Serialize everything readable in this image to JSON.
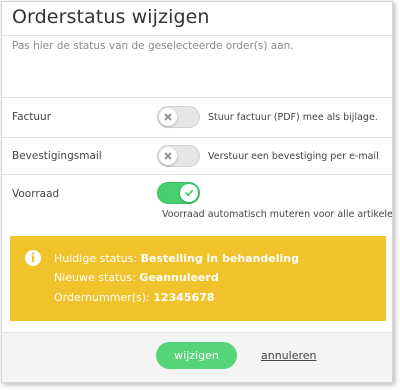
{
  "dialog": {
    "title": "Orderstatus wijzigen",
    "subtitle": "Pas hier de status van de geselecteerde order(s) aan."
  },
  "options": [
    {
      "label": "Factuur",
      "enabled": false,
      "knob_icon": "x-icon",
      "description": "Stuur factuur (PDF) mee als bijlage."
    },
    {
      "label": "Bevestigingsmail",
      "enabled": false,
      "knob_icon": "x-icon",
      "description": "Verstuur een bevestiging per e-mail"
    },
    {
      "label": "Voorraad",
      "enabled": true,
      "knob_icon": "check-icon",
      "description": "Voorraad automatisch muteren voor alle artikelen."
    }
  ],
  "info": {
    "icon": "info-icon",
    "current_label": "Huidige status:",
    "current_value": "Bestelling in behandeling",
    "new_label": "Nieuwe status:",
    "new_value": "Geannuleerd",
    "order_label": "Ordernummer(s):",
    "order_value": "12345678"
  },
  "actions": {
    "confirm_label": "wijzigen",
    "cancel_label": "annuleren"
  },
  "colors": {
    "toggle_on": "#46cf6f",
    "toggle_off": "#e6e6e6",
    "alert_background": "#f0c22b",
    "primary_button": "#55d47a"
  }
}
